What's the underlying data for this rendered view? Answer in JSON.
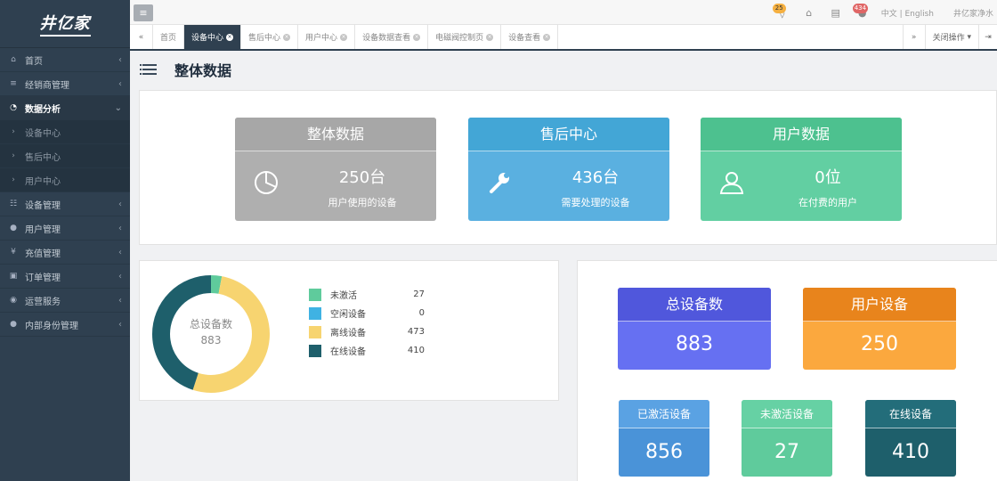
{
  "logo": "井亿家",
  "sidebar": {
    "items": [
      {
        "label": "首页",
        "icon": "home-icon"
      },
      {
        "label": "经销商管理",
        "icon": "sliders-icon"
      },
      {
        "label": "数据分析",
        "icon": "chart-icon"
      },
      {
        "label": "设备中心",
        "icon": "chevron-right-icon"
      },
      {
        "label": "售后中心",
        "icon": "chevron-right-icon"
      },
      {
        "label": "用户中心",
        "icon": "chevron-right-icon"
      },
      {
        "label": "设备管理",
        "icon": "sitemap-icon"
      },
      {
        "label": "用户管理",
        "icon": "user-icon"
      },
      {
        "label": "充值管理",
        "icon": "yen-icon"
      },
      {
        "label": "订单管理",
        "icon": "book-icon"
      },
      {
        "label": "运营服务",
        "icon": "comments-icon"
      },
      {
        "label": "内部身份管理",
        "icon": "users-icon"
      }
    ]
  },
  "topbar": {
    "badge_left": "25",
    "badge_right": "434",
    "lang": "中文 | English",
    "user": "井亿家净水"
  },
  "tabs": [
    "首页",
    "设备中心",
    "售后中心",
    "用户中心",
    "设备数据查看",
    "电磁阀控制页",
    "设备查看"
  ],
  "tabs_close_ops": "关闭操作",
  "page_title": "整体数据",
  "kpis": [
    {
      "title": "整体数据",
      "value": "250台",
      "sub": "用户使用的设备"
    },
    {
      "title": "售后中心",
      "value": "436台",
      "sub": "需要处理的设备"
    },
    {
      "title": "用户数据",
      "value": "0位",
      "sub": "在付费的用户"
    }
  ],
  "donut": {
    "center_label": "总设备数",
    "center_value": "883",
    "legend": [
      {
        "name": "未激活",
        "value": "27",
        "color": "#5fcb9c"
      },
      {
        "name": "空闲设备",
        "value": "0",
        "color": "#3fb2e3"
      },
      {
        "name": "离线设备",
        "value": "473",
        "color": "#f7d470"
      },
      {
        "name": "在线设备",
        "value": "410",
        "color": "#1e5f6b"
      }
    ]
  },
  "stats": {
    "total": {
      "label": "总设备数",
      "value": "883"
    },
    "user": {
      "label": "用户设备",
      "value": "250"
    },
    "activated": {
      "label": "已激活设备",
      "value": "856"
    },
    "inactive": {
      "label": "未激活设备",
      "value": "27"
    },
    "online": {
      "label": "在线设备",
      "value": "410"
    }
  }
}
